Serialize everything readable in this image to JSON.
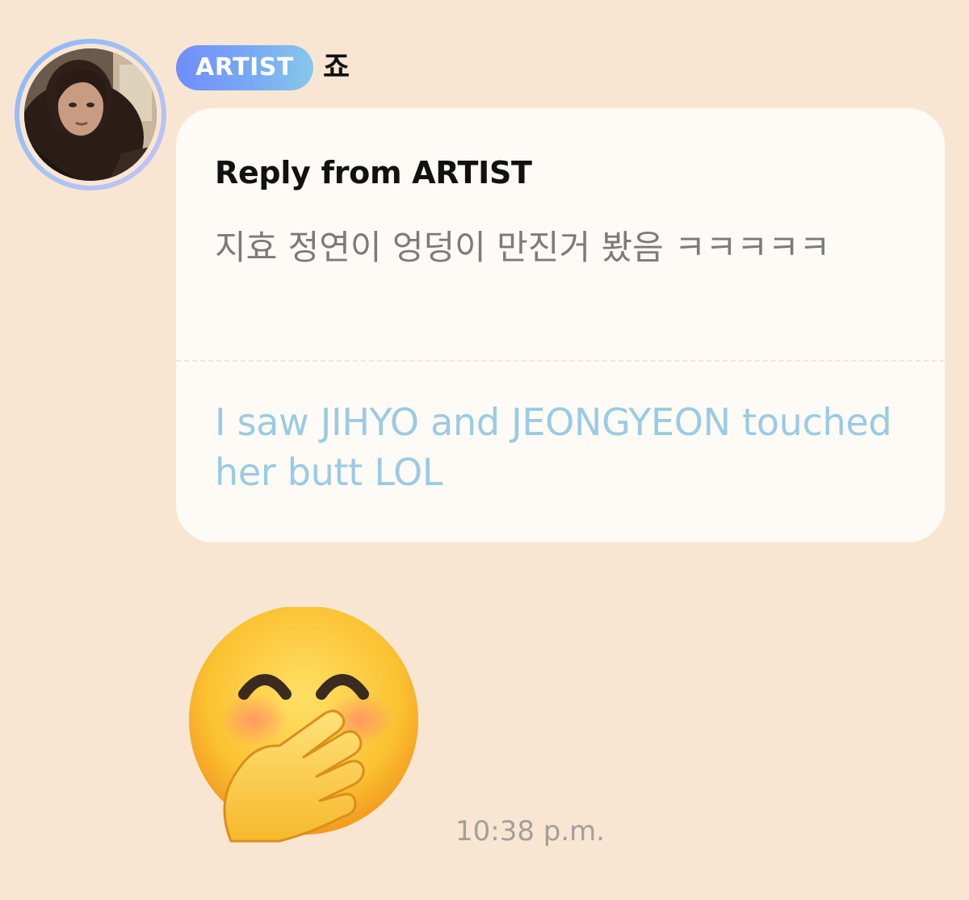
{
  "message": {
    "badge_label": "ARTIST",
    "author_name": "죠",
    "reply_title": "Reply from ARTIST",
    "original_text": "지효 정연이 엉덩이 만진거 봤음 ㅋㅋㅋㅋㅋ",
    "translation_text": "I saw JIHYO and JEONGYEON touched her butt LOL",
    "timestamp": "10:38 p.m."
  },
  "icons": {
    "avatar": "profile-photo",
    "emoji": "face-with-hand-over-mouth-emoji"
  },
  "colors": {
    "background": "#f8e6d3",
    "bubble": "#fefaf5",
    "badge_start": "#6f8dfd",
    "badge_end": "#86c8ea",
    "translation": "#9acbe3",
    "original_text": "#7b7b7b",
    "timestamp": "#a59e98"
  }
}
